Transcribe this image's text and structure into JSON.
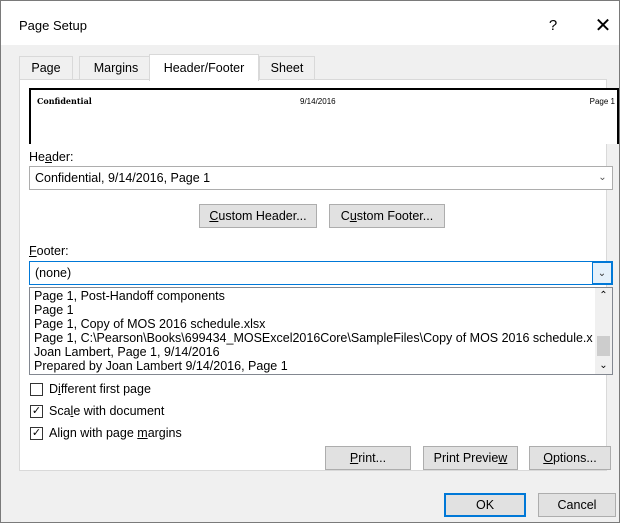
{
  "window": {
    "title": "Page Setup",
    "help": "?",
    "close": "✕"
  },
  "tabs": [
    {
      "label": "Page"
    },
    {
      "label": "Margins"
    },
    {
      "label": "Header/Footer"
    },
    {
      "label": "Sheet"
    }
  ],
  "preview": {
    "left": "Confidential",
    "center": "9/14/2016",
    "right": "Page 1"
  },
  "header": {
    "label_pre": "He",
    "label_key": "a",
    "label_post": "der:",
    "value": "Confidential, 9/14/2016, Page 1"
  },
  "buttons": {
    "custom_header": {
      "key": "C",
      "rest": "ustom Header..."
    },
    "custom_footer": {
      "pre": "C",
      "key": "u",
      "rest": "stom Footer..."
    },
    "print": {
      "key": "P",
      "rest": "rint..."
    },
    "print_preview": {
      "pre": "Print Previe",
      "key": "w",
      "rest": ""
    },
    "options": {
      "key": "O",
      "rest": "ptions..."
    },
    "ok": "OK",
    "cancel": "Cancel"
  },
  "footer": {
    "label_key": "F",
    "label_rest": "ooter:",
    "value": "(none)",
    "options": [
      "Page 1, Post-Handoff components",
      "Page 1",
      "Page 1, Copy of MOS 2016 schedule.xlsx",
      "Page 1, C:\\Pearson\\Books\\699434_MOSExcel2016Core\\SampleFiles\\Copy of MOS 2016 schedule.x",
      "Joan Lambert, Page 1, 9/14/2016",
      "Prepared by Joan Lambert 9/14/2016, Page 1"
    ]
  },
  "checkboxes": {
    "different_first": {
      "pre": "D",
      "key": "i",
      "rest": "fferent first page",
      "checked": false
    },
    "scale": {
      "pre": "Sca",
      "key": "l",
      "rest": "e with document",
      "checked": true
    },
    "align": {
      "pre": "Align with page ",
      "key": "m",
      "rest": "argins",
      "checked": true
    }
  },
  "icons": {
    "dropdown": "chevron-down-icon",
    "scroll_up": "chevron-up-icon",
    "check": "checkmark-icon"
  }
}
